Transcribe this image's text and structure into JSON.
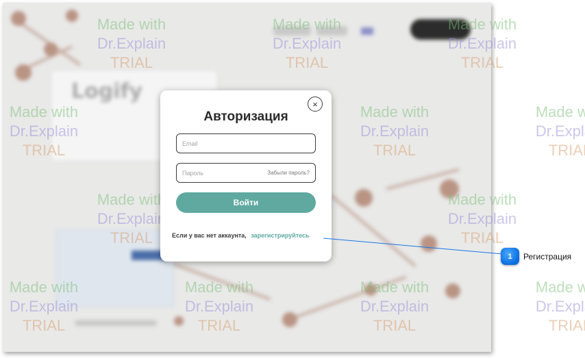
{
  "modal": {
    "title": "Авторизация",
    "close_glyph": "×",
    "email_placeholder": "Email",
    "password_placeholder": "Пароль",
    "forgot_password": "Забыли пароль?",
    "login_button": "Войти",
    "no_account_text": "Если у вас нет аккаунта,",
    "signup_link": "зарегистрируйтесь"
  },
  "background_app": {
    "logo_text": "Logify"
  },
  "callout": {
    "number": "1",
    "label": "Регистрация",
    "color": "#0a6ee0"
  },
  "watermark": {
    "line1": "Made with",
    "line2": "Dr.Explain",
    "line3": "TRIAL"
  },
  "colors": {
    "accent": "#5fa9a0",
    "callout": "#1677e6"
  }
}
